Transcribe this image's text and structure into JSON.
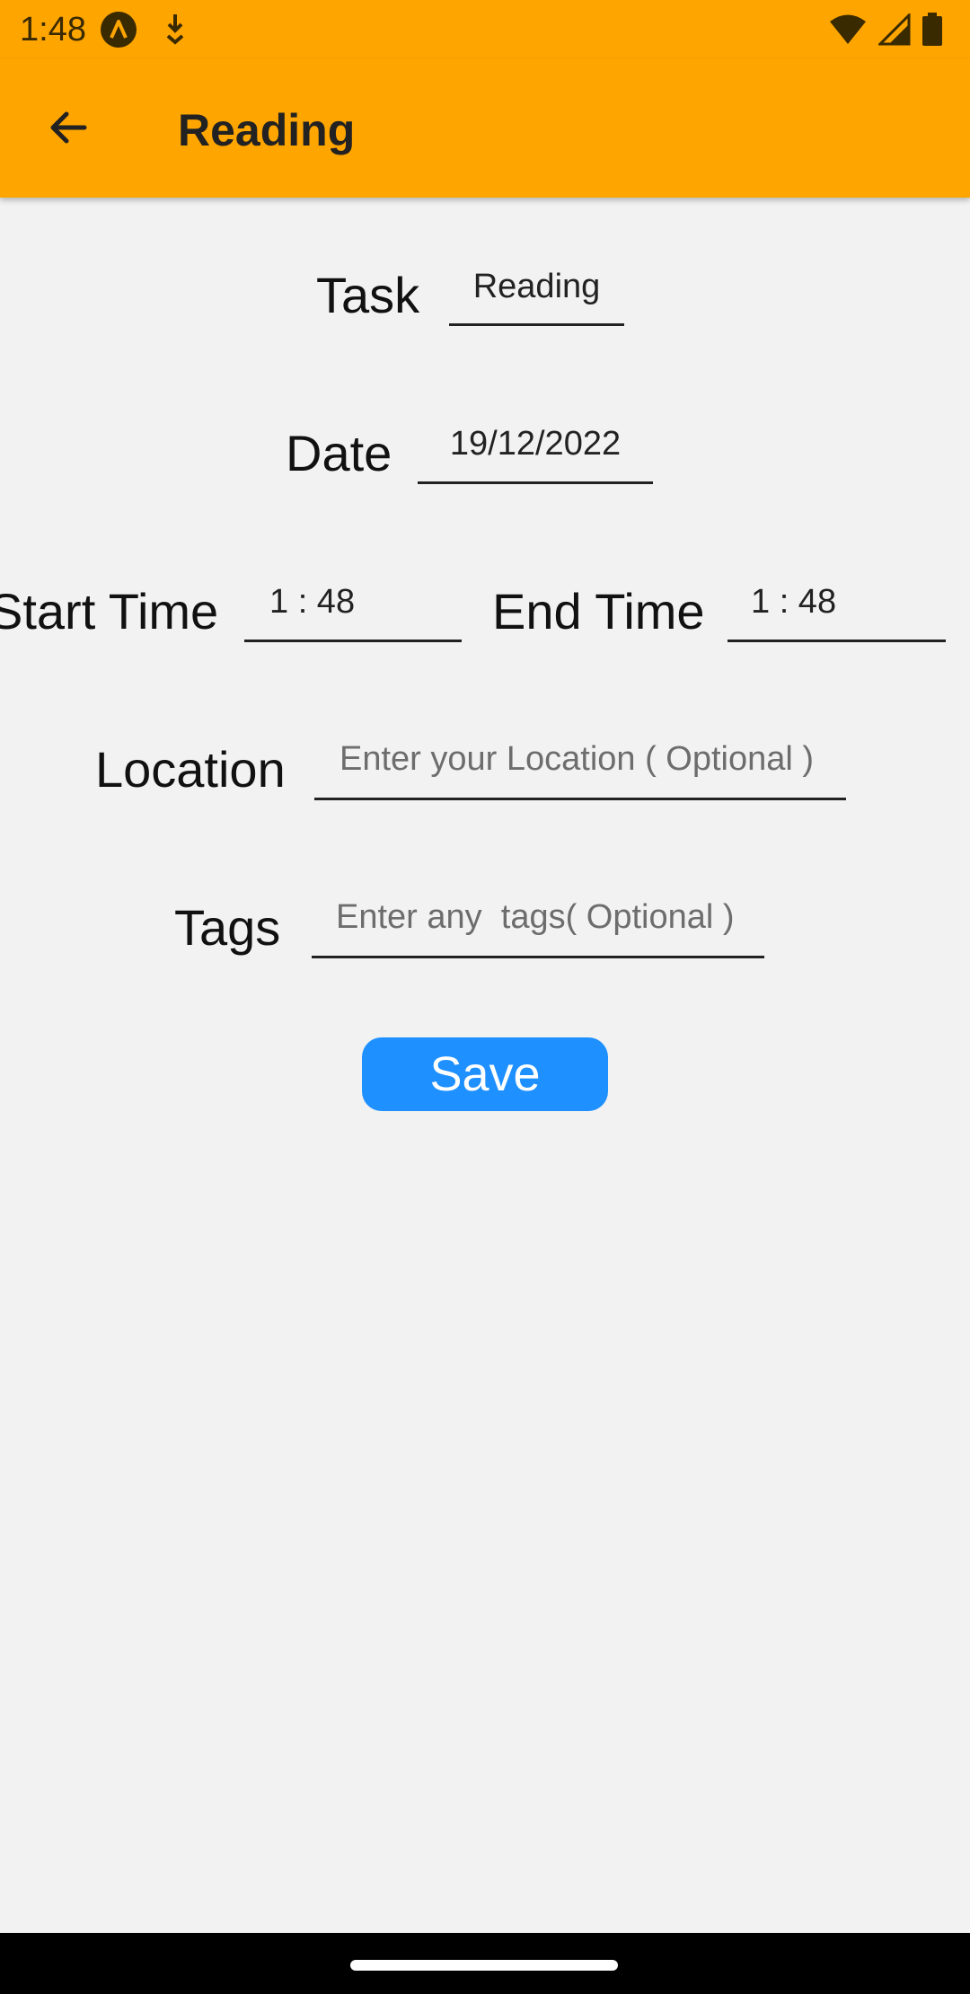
{
  "status_bar": {
    "time": "1:48"
  },
  "app_bar": {
    "title": "Reading",
    "back_icon": "arrow-left-icon"
  },
  "form": {
    "task": {
      "label": "Task",
      "value": "Reading"
    },
    "date": {
      "label": "Date",
      "value": "19/12/2022"
    },
    "start_time": {
      "label": "Start Time",
      "value": "1 : 48"
    },
    "end_time": {
      "label": "End Time",
      "value": "1 : 48"
    },
    "location": {
      "label": "Location",
      "placeholder": "Enter your Location ( Optional )"
    },
    "tags": {
      "label": "Tags",
      "placeholder": "Enter any  tags( Optional )"
    },
    "save_label": "Save"
  },
  "colors": {
    "app_bar": "#ffa500",
    "background": "#f2f2f2",
    "save_button": "#1e90ff"
  }
}
